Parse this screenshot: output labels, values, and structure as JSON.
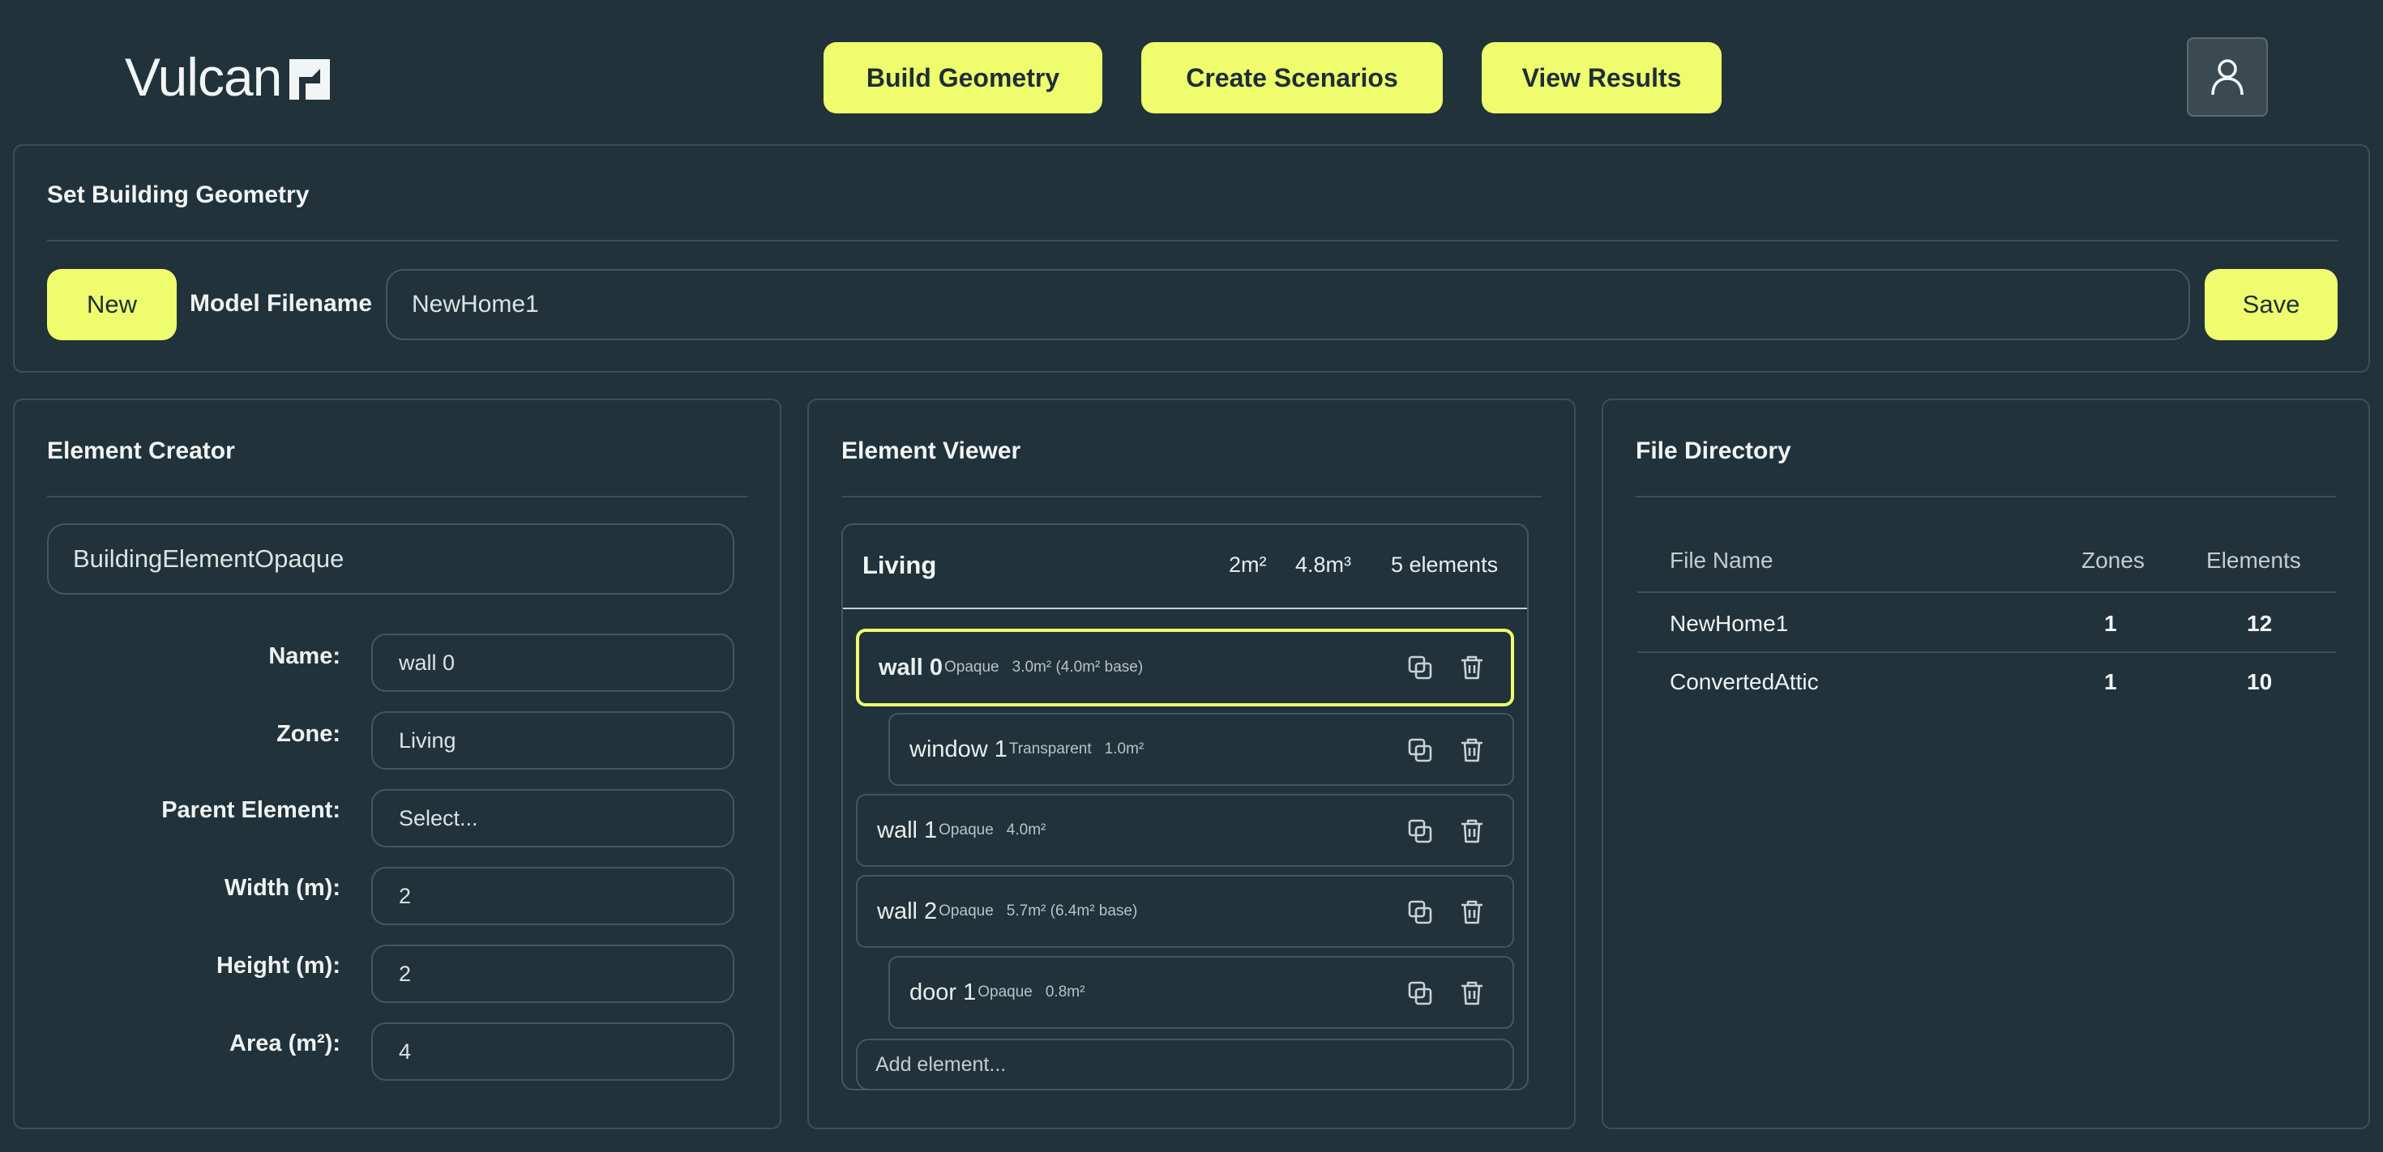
{
  "app": {
    "logo_text": "Vulcan"
  },
  "nav": {
    "build_geometry": "Build Geometry",
    "create_scenarios": "Create Scenarios",
    "view_results": "View Results"
  },
  "geometry": {
    "title": "Set Building Geometry",
    "new_label": "New",
    "filename_label": "Model Filename",
    "filename_value": "NewHome1",
    "save_label": "Save"
  },
  "creator": {
    "title": "Element Creator",
    "element_type": "BuildingElementOpaque",
    "fields": [
      {
        "label": "Name:",
        "value": "wall 0"
      },
      {
        "label": "Zone:",
        "value": "Living"
      },
      {
        "label": "Parent Element:",
        "value": "Select..."
      },
      {
        "label": "Width (m):",
        "value": "2"
      },
      {
        "label": "Height (m):",
        "value": "2"
      },
      {
        "label": "Area (m²):",
        "value": "4"
      }
    ]
  },
  "viewer": {
    "title": "Element Viewer",
    "zone": {
      "name": "Living",
      "area": "2m²",
      "volume": "4.8m³",
      "count": "5 elements"
    },
    "elements": [
      {
        "name": "wall 0",
        "type": "Opaque",
        "area": "3.0m² (4.0m² base)"
      },
      {
        "name": "window 1",
        "type": "Transparent",
        "area": "1.0m²"
      },
      {
        "name": "wall 1",
        "type": "Opaque",
        "area": "4.0m²"
      },
      {
        "name": "wall 2",
        "type": "Opaque",
        "area": "5.7m² (6.4m² base)"
      },
      {
        "name": "door 1",
        "type": "Opaque",
        "area": "0.8m²"
      }
    ],
    "add_placeholder": "Add element..."
  },
  "directory": {
    "title": "File Directory",
    "columns": [
      "File Name",
      "Zones",
      "Elements"
    ],
    "rows": [
      {
        "name": "NewHome1",
        "zones": "1",
        "elements": "12"
      },
      {
        "name": "ConvertedAttic",
        "zones": "1",
        "elements": "10"
      }
    ]
  },
  "colors": {
    "background": "#21323a",
    "accent": "#eefc6d",
    "border": "#3d4f56"
  }
}
